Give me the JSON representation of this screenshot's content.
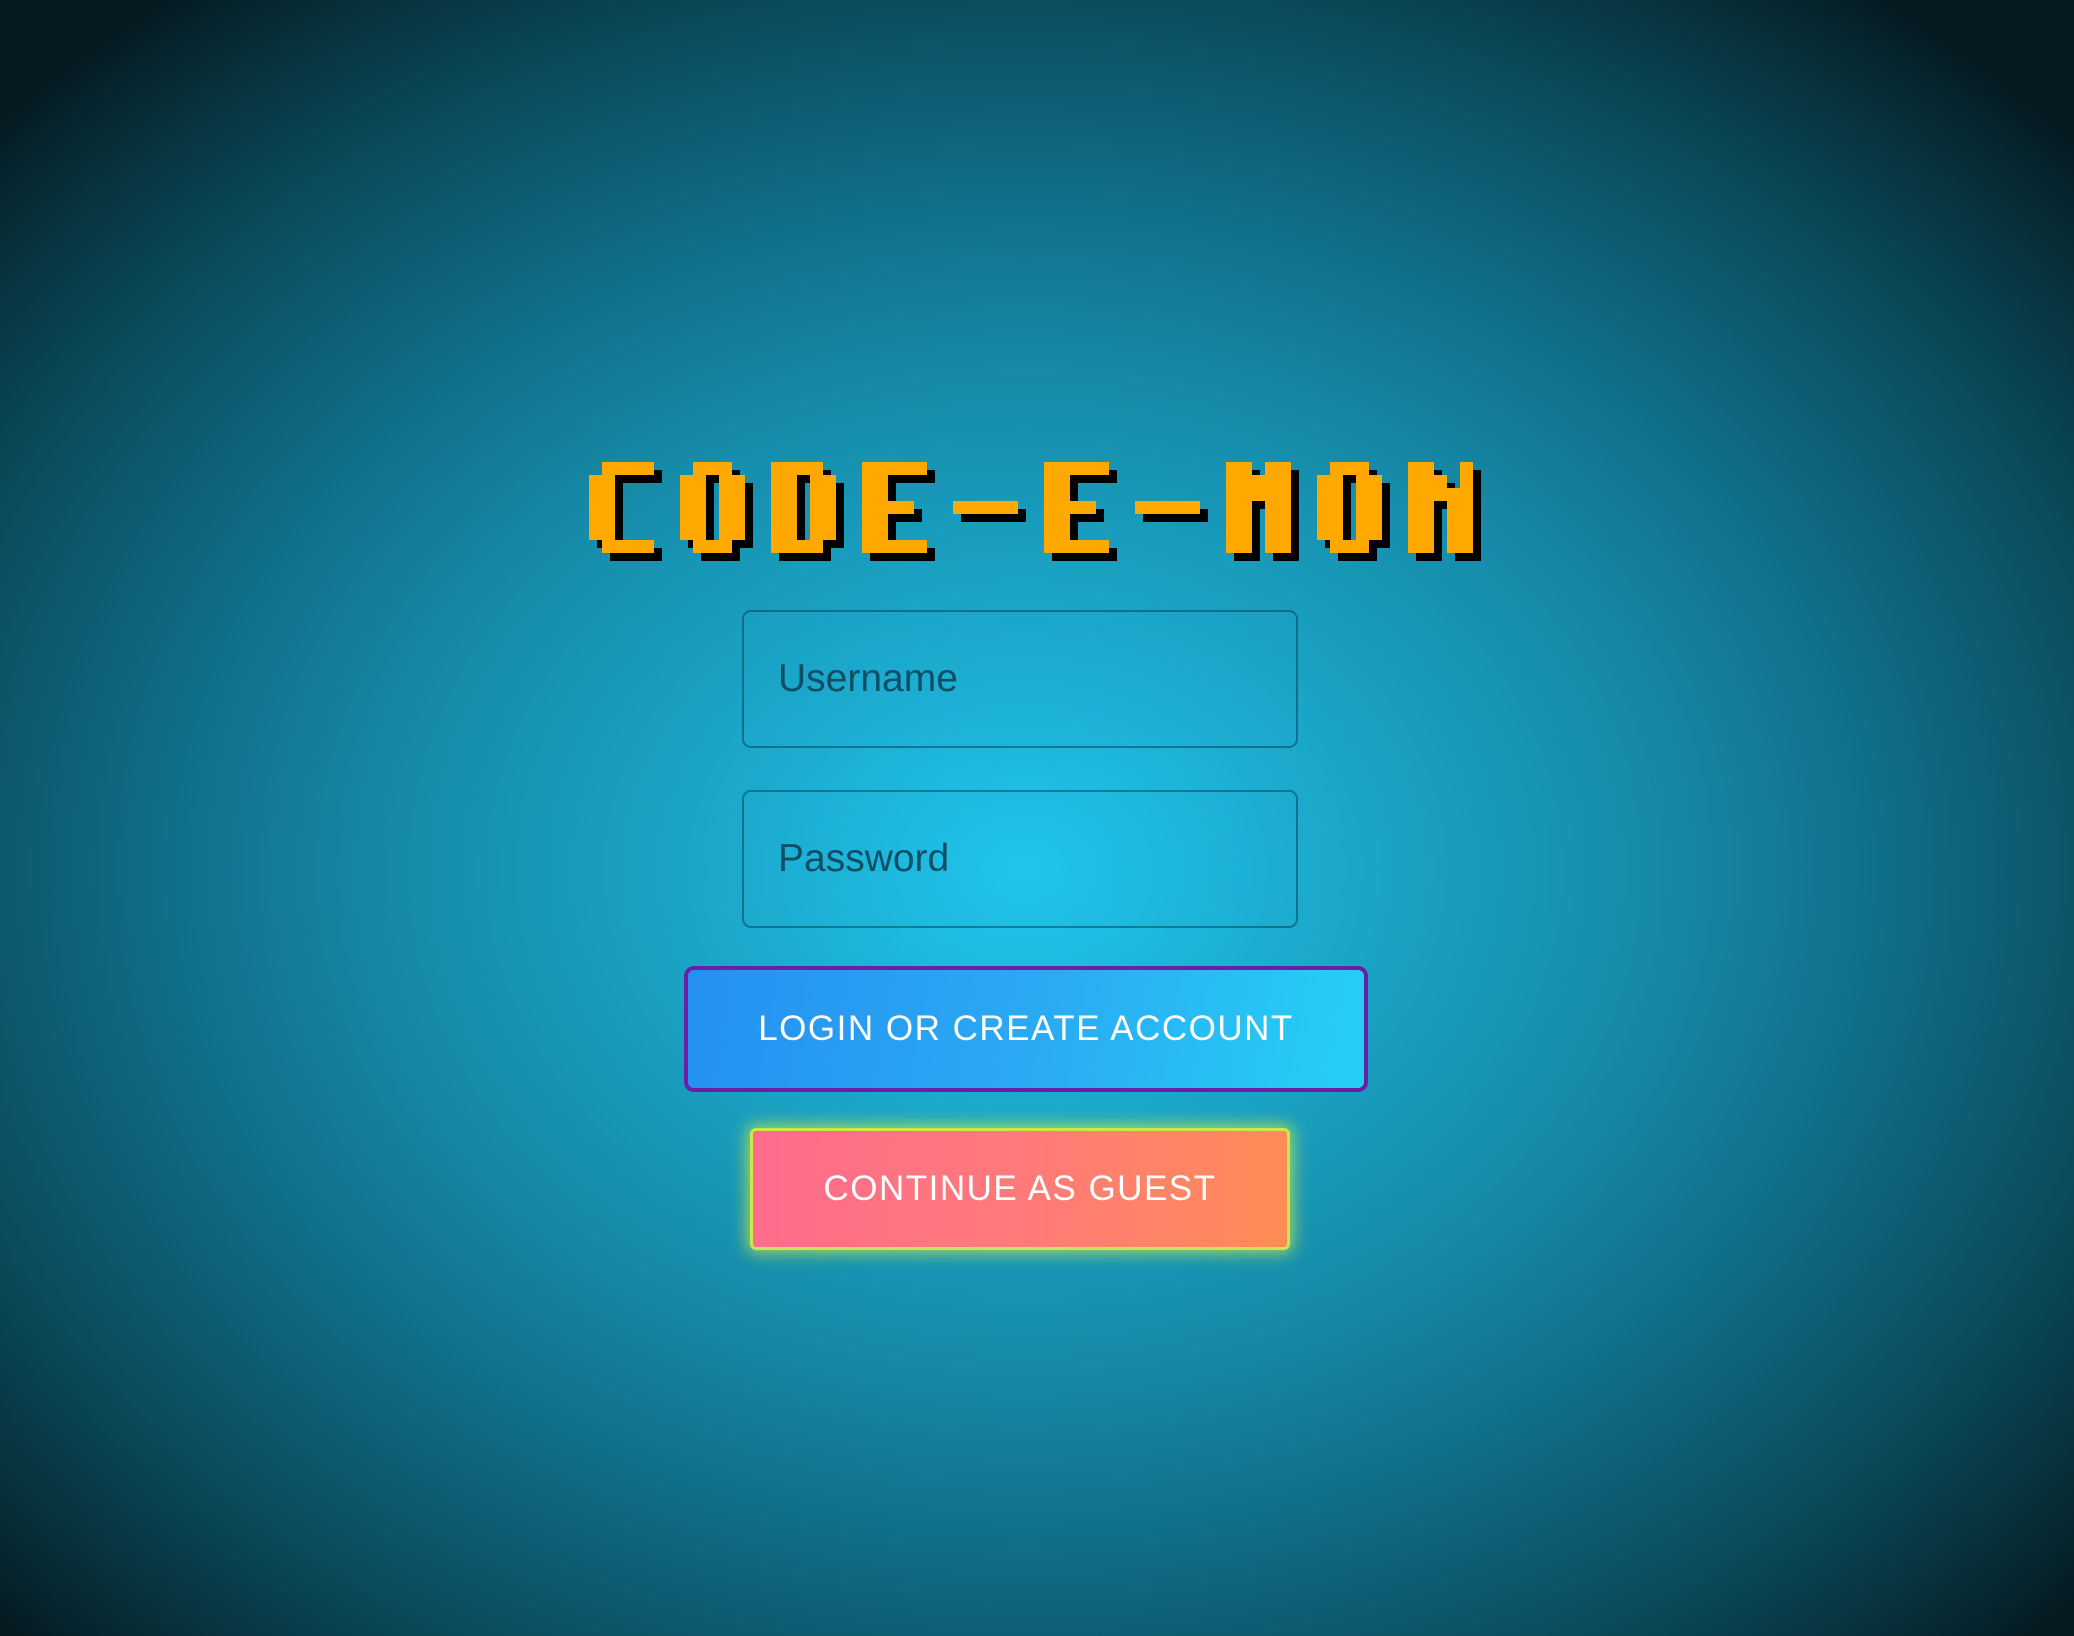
{
  "title": {
    "text": "CODE-E-MON",
    "color": "#ffa800",
    "shadow_color": "#000000"
  },
  "login_form": {
    "username_placeholder": "Username",
    "password_placeholder": "Password",
    "login_button_label": "LOGIN OR CREATE ACCOUNT",
    "guest_button_label": "CONTINUE AS GUEST"
  },
  "colors": {
    "background_center": "#20c8ee",
    "background_edge": "#041a20",
    "login_button_start": "#2590f2",
    "login_button_end": "#26d0f5",
    "login_button_border": "#6c1fa6",
    "guest_button_start": "#ff6b8d",
    "guest_button_end": "#ff8c55",
    "guest_button_glow": "#c9e84a"
  }
}
